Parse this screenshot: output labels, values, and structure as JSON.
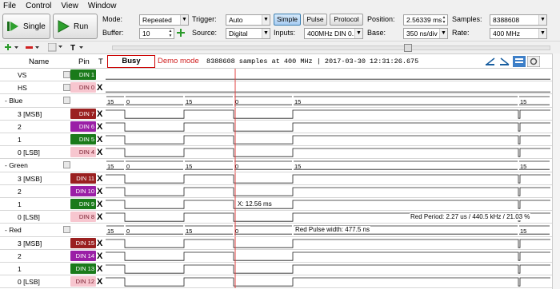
{
  "menu": [
    "File",
    "Control",
    "View",
    "Window"
  ],
  "toolbar": {
    "single_label": "Single",
    "run_label": "Run",
    "mode_label": "Mode:",
    "mode_value": "Repeated",
    "buffer_label": "Buffer:",
    "buffer_value": "10",
    "trigger_label": "Trigger:",
    "trigger_value": "Auto",
    "source_label": "Source:",
    "source_value": "Digital",
    "simple_label": "Simple",
    "pulse_label": "Pulse",
    "protocol_label": "Protocol",
    "inputs_label": "Inputs:",
    "inputs_value": "400MHz DIN 0...",
    "position_label": "Position:",
    "position_value": "2.56339 ms",
    "base_label": "Base:",
    "base_value": "350 ns/div",
    "samples_label": "Samples:",
    "samples_value": "8388608",
    "rate_label": "Rate:",
    "rate_value": "400 MHz"
  },
  "header": {
    "name_col": "Name",
    "pin_col": "Pin",
    "t_col": "T",
    "busy_label": "Busy",
    "demo_label": "Demo mode",
    "info_text": "8388608 samples at 400 MHz | 2017-03-30 12:31:26.675"
  },
  "annotations": {
    "cursor_x": "X: 12.56 ms",
    "red_period": "Red Period: 2.27 us / 440.5 kHz / 21.03 %",
    "red_pulse": "Red Pulse width: 477.5 ns"
  },
  "bus_values": [
    "15",
    "0",
    "15",
    "0",
    "15",
    "15"
  ],
  "signals": [
    {
      "name": "VS",
      "pin": "DIN 1",
      "color": "#1a7a1a",
      "x": "",
      "type": "sig"
    },
    {
      "name": "HS",
      "pin": "DIN 0",
      "color": "#f7c6cf",
      "x": "X",
      "type": "sig"
    },
    {
      "name": "Blue",
      "type": "group"
    },
    {
      "name": "3 [MSB]",
      "pin": "DIN 7",
      "color": "#9a2020",
      "x": "X",
      "type": "sig"
    },
    {
      "name": "2",
      "pin": "DIN 6",
      "color": "#9a1fa6",
      "x": "X",
      "type": "sig"
    },
    {
      "name": "1",
      "pin": "DIN 5",
      "color": "#1a7a1a",
      "x": "X",
      "type": "sig"
    },
    {
      "name": "0 [LSB]",
      "pin": "DIN 4",
      "color": "#f7c6cf",
      "x": "X",
      "type": "sig"
    },
    {
      "name": "Green",
      "type": "group"
    },
    {
      "name": "3 [MSB]",
      "pin": "DIN 11",
      "color": "#9a2020",
      "x": "X",
      "type": "sig"
    },
    {
      "name": "2",
      "pin": "DIN 10",
      "color": "#9a1fa6",
      "x": "X",
      "type": "sig"
    },
    {
      "name": "1",
      "pin": "DIN 9",
      "color": "#1a7a1a",
      "x": "X",
      "type": "sig"
    },
    {
      "name": "0 [LSB]",
      "pin": "DIN 8",
      "color": "#f7c6cf",
      "x": "X",
      "type": "sig"
    },
    {
      "name": "Red",
      "type": "group"
    },
    {
      "name": "3 [MSB]",
      "pin": "DIN 15",
      "color": "#9a2020",
      "x": "X",
      "type": "sig"
    },
    {
      "name": "2",
      "pin": "DIN 14",
      "color": "#9a1fa6",
      "x": "X",
      "type": "sig"
    },
    {
      "name": "1",
      "pin": "DIN 13",
      "color": "#1a7a1a",
      "x": "X",
      "type": "sig"
    },
    {
      "name": "0 [LSB]",
      "pin": "DIN 12",
      "color": "#f7c6cf",
      "x": "X",
      "type": "sig"
    }
  ]
}
